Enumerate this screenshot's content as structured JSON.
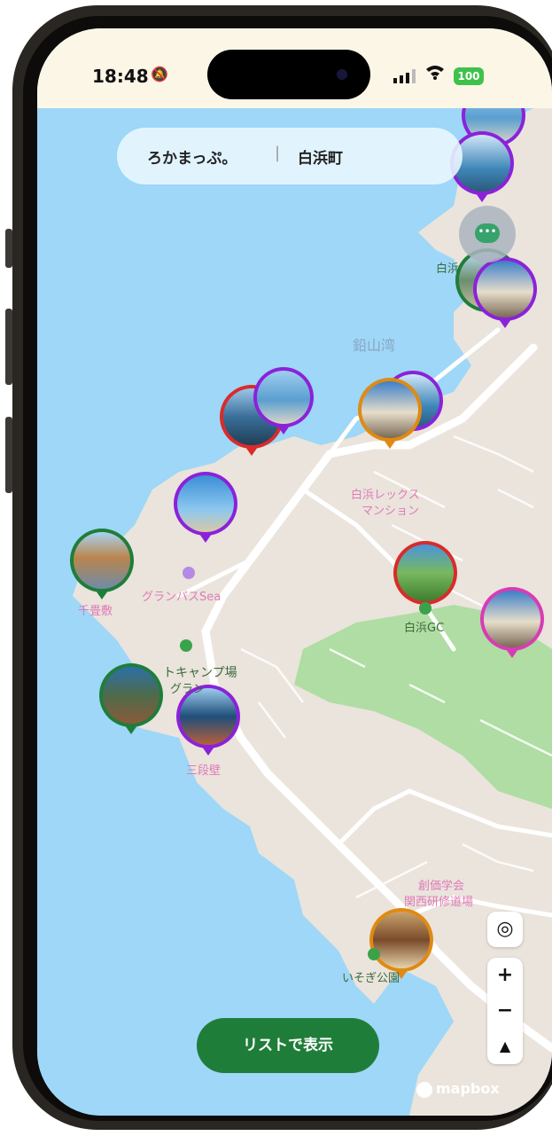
{
  "status_bar": {
    "time": "18:48",
    "battery": "100"
  },
  "header": {
    "app_name": "ろかまっぷ。",
    "separator": "|",
    "town": "白浜町"
  },
  "map_labels": [
    {
      "text": "鉛山湾",
      "color": "#8aa4c2"
    },
    {
      "text": "白浜レックス",
      "color": "#e07ab7"
    },
    {
      "text": "マンション",
      "color": "#e07ab7"
    },
    {
      "text": "グランパスSea",
      "color": "#e07ab7"
    },
    {
      "text": "千畳敷",
      "color": "#e07ab7"
    },
    {
      "text": "白浜GC",
      "color": "#3b6b3b"
    },
    {
      "text": "トキャンプ場",
      "color": "#3b6b3b"
    },
    {
      "text": "グラン",
      "color": "#3b6b3b"
    },
    {
      "text": "三段壁",
      "color": "#e07ab7"
    },
    {
      "text": "創価学会",
      "color": "#e07ab7"
    },
    {
      "text": "関西研修道場",
      "color": "#e07ab7"
    },
    {
      "text": "いそぎ公園",
      "color": "#3b6b3b"
    },
    {
      "text": "白浜",
      "color": "#3b6b3b"
    }
  ],
  "pins": [
    {
      "color": "#8b22d9",
      "photo": "sea"
    },
    {
      "color": "#8b22d9",
      "photo": "boats"
    },
    {
      "color": "#1f7d3a",
      "photo": "shore"
    },
    {
      "color": "#8b22d9",
      "photo": "building"
    },
    {
      "color": "#d92b2b",
      "photo": "bay"
    },
    {
      "color": "#8b22d9",
      "photo": "sea"
    },
    {
      "color": "#8b22d9",
      "photo": "boats"
    },
    {
      "color": "#e08a12",
      "photo": "building"
    },
    {
      "color": "#8b22d9",
      "photo": "sky"
    },
    {
      "color": "#1f7d3a",
      "photo": "rocks"
    },
    {
      "color": "#d92b2b",
      "photo": "field"
    },
    {
      "color": "#d93bb5",
      "photo": "building"
    },
    {
      "color": "#1f7d3a",
      "photo": "cliff"
    },
    {
      "color": "#8b22d9",
      "photo": "road"
    },
    {
      "color": "#e08a12",
      "photo": "room"
    }
  ],
  "chat_icon": "chat-bubble-icon",
  "list_button": {
    "label": "リストで表示"
  },
  "controls": {
    "locate_icon": "target-icon",
    "zoom_in": "+",
    "zoom_out": "−",
    "compass_icon": "compass-icon"
  },
  "attribution": {
    "text": "mapbox"
  },
  "colors": {
    "water": "#9ed7f7",
    "land": "#eae4dc",
    "park": "#a8dc9c",
    "button": "#1f7d3a"
  }
}
